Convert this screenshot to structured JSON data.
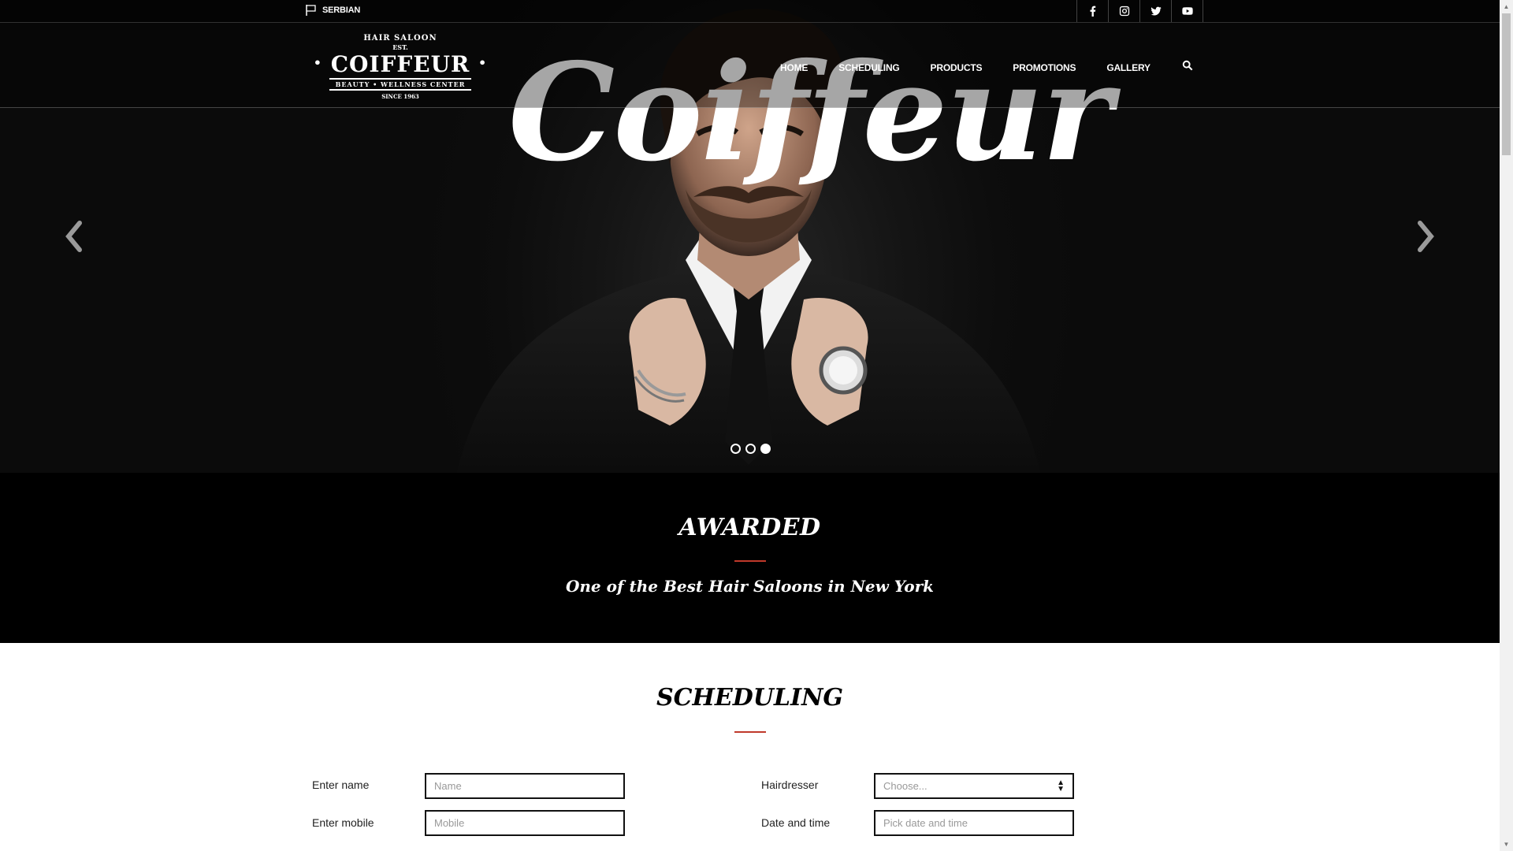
{
  "topbar": {
    "language": "SERBIAN",
    "social": [
      "facebook-icon",
      "instagram-icon",
      "twitter-icon",
      "youtube-icon"
    ]
  },
  "logo": {
    "line1": "HAIR SALOON",
    "line2": "EST.",
    "name": "COIFFEUR",
    "tagline": "BEAUTY • WELLNESS CENTER",
    "since": "SINCE 1963"
  },
  "nav": {
    "items": [
      "HOME",
      "SCHEDULING",
      "PRODUCTS",
      "PROMOTIONS",
      "GALLERY"
    ],
    "search_icon": "search-icon"
  },
  "hero": {
    "big_text": "Coiffeur",
    "slides_total": 3,
    "active_slide": 3
  },
  "awarded": {
    "title": "AWARDED",
    "subtitle": "One of the Best Hair Saloons in New York"
  },
  "scheduling": {
    "title": "SCHEDULING",
    "name_label": "Enter name",
    "name_placeholder": "Name",
    "mobile_label": "Enter mobile",
    "mobile_placeholder": "Mobile",
    "hairdresser_label": "Hairdresser",
    "hairdresser_value": "Choose...",
    "datetime_label": "Date and time",
    "datetime_placeholder": "Pick date and time"
  },
  "colors": {
    "accent": "#c0392b",
    "dark": "#000000",
    "text": "#ffffff"
  }
}
